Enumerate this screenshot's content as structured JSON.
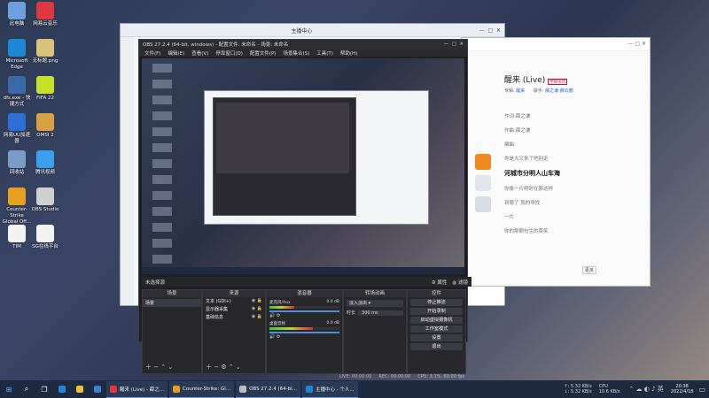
{
  "desktop": {
    "icons": [
      {
        "label": "此电脑",
        "color": "#6da0e0"
      },
      {
        "label": "网易云音乐",
        "color": "#e0383e"
      },
      {
        "label": "Microsoft Edge",
        "color": "#1e88d8"
      },
      {
        "label": "无标题.png",
        "color": "#d9c27a"
      },
      {
        "label": "dfs.exe - 快捷方式",
        "color": "#3a6aa8"
      },
      {
        "label": "FIFA 22",
        "color": "#c8e02a"
      },
      {
        "label": "网易UU加速器",
        "color": "#2d6fd8"
      },
      {
        "label": "OMSI 2",
        "color": "#d8a040"
      },
      {
        "label": "回收站",
        "color": "#7b9cc8"
      },
      {
        "label": "腾讯视频",
        "color": "#3aa0f0"
      },
      {
        "label": "Counter-Strike Global Off...",
        "color": "#e8a020"
      },
      {
        "label": "OBS Studio",
        "color": "#cfcfcf"
      },
      {
        "label": "TIM",
        "color": "#f2f2f2"
      },
      {
        "label": "SG在线平台",
        "color": "#f2f2f2"
      }
    ]
  },
  "center_window": {
    "title": "主播中心"
  },
  "live_window": {
    "title": "醒来 (Live)",
    "badge": "中国电台",
    "album_label": "专辑:",
    "album": "醒来",
    "singer_label": "歌手:",
    "singer": "薛之谦·薛云鹏",
    "lyrics": [
      "作词:薛之谦",
      "作曲:薛之谦",
      "编曲:",
      "你是大又来了吧别走",
      "河城市分明人山车海",
      "你像一片明时在那这样",
      "到哪了 我的寻找",
      "一片",
      "你的那颗包生的菜笑"
    ]
  },
  "obs": {
    "title": "OBS 27.2.4 (64-bit, windows) - 配置文件: 未命名 - 场景: 未命名",
    "menu": [
      "文件(F)",
      "编辑(E)",
      "查看(V)",
      "停靠窗口(D)",
      "配置文件(P)",
      "场景集合(S)",
      "工具(T)",
      "帮助(H)"
    ],
    "scene_bar": {
      "label": "未选择源",
      "properties": "属性",
      "filters": "滤镜"
    },
    "scenes": {
      "header": "场景",
      "items": [
        "场景"
      ]
    },
    "sources": {
      "header": "来源",
      "items": [
        "文本 (GDI+)",
        "显示器采集",
        "基础信息"
      ]
    },
    "mixer": {
      "header": "混音器",
      "tracks": [
        {
          "name": "麦克风/Aux",
          "db": "0.0 dB",
          "level": 0.35
        },
        {
          "name": "桌面音频",
          "db": "0.0 dB",
          "level": 0.62
        }
      ]
    },
    "transitions": {
      "header": "转场动画",
      "type": "淡入淡出",
      "duration_label": "时长",
      "duration": "300 ms"
    },
    "controls": {
      "header": "控件",
      "buttons": [
        "停止推流",
        "开始录制",
        "启动虚拟摄像机",
        "工作室模式",
        "设置",
        "退出"
      ]
    },
    "status": {
      "live": "LIVE: 00:00:00",
      "rec": "REC: 00:00:00",
      "cpu": "CPU: 3.1%, 60.00 fps"
    }
  },
  "taskbar": {
    "apps": [
      {
        "label": "醒来 (Live) - 薛之...",
        "color": "#e0383e"
      },
      {
        "label": "Counter-Strike: Gl...",
        "color": "#e8a020"
      },
      {
        "label": "OBS 27.2.4 (64-bi...",
        "color": "#bdbdbd"
      },
      {
        "label": "主播中心 - 个人...",
        "color": "#1e88d8"
      }
    ],
    "net_up": "↑: 5.32 KB/s",
    "net_down": "↓: 5.32 KB/s",
    "cpu": "CPU",
    "speed": "10.6 KB/s",
    "time": "20:38",
    "date": "2022/4/18"
  }
}
